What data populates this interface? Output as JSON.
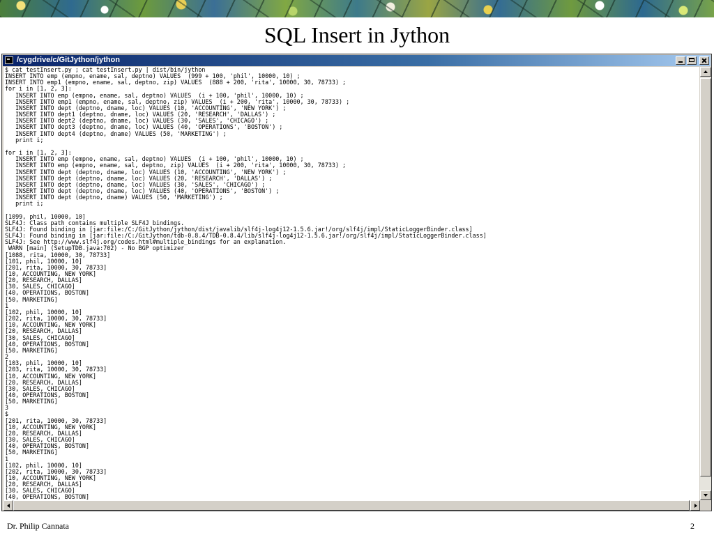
{
  "slide": {
    "title": "SQL Insert in Jython",
    "author": "Dr. Philip Cannata",
    "page_number": "2"
  },
  "window": {
    "title": "/cygdrive/c/GitJython/jython",
    "buttons": [
      "minimize-icon",
      "maximize-icon",
      "close-icon"
    ],
    "terminal_lines": [
      "$ cat testInsert.py ; cat testInsert.py | dist/bin/jython",
      "INSERT INTO emp (empno, ename, sal, deptno) VALUES  (999 + 100, 'phil', 10000, 10) ;",
      "INSERT INTO emp1 (empno, ename, sal, deptno, zip) VALUES  (888 + 200, 'rita', 10000, 30, 78733) ;",
      "for i in [1, 2, 3]:",
      "   INSERT INTO emp (empno, ename, sal, deptno) VALUES  (i + 100, 'phil', 10000, 10) ;",
      "   INSERT INTO emp1 (empno, ename, sal, deptno, zip) VALUES  (i + 200, 'rita', 10000, 30, 78733) ;",
      "   INSERT INTO dept (deptno, dname, loc) VALUES (10, 'ACCOUNTING', 'NEW YORK') ;",
      "   INSERT INTO dept1 (deptno, dname, loc) VALUES (20, 'RESEARCH', 'DALLAS') ;",
      "   INSERT INTO dept2 (deptno, dname, loc) VALUES (30, 'SALES', 'CHICAGO') ;",
      "   INSERT INTO dept3 (deptno, dname, loc) VALUES (40, 'OPERATIONS', 'BOSTON') ;",
      "   INSERT INTO dept4 (deptno, dname) VALUES (50, 'MARKETING') ;",
      "   print i;",
      "",
      "for i in [1, 2, 3]:",
      "   INSERT INTO emp (empno, ename, sal, deptno) VALUES  (i + 100, 'phil', 10000, 10) ;",
      "   INSERT INTO emp (empno, ename, sal, deptno, zip) VALUES  (i + 200, 'rita', 10000, 30, 78733) ;",
      "   INSERT INTO dept (deptno, dname, loc) VALUES (10, 'ACCOUNTING', 'NEW YORK') ;",
      "   INSERT INTO dept (deptno, dname, loc) VALUES (20, 'RESEARCH', 'DALLAS') ;",
      "   INSERT INTO dept (deptno, dname, loc) VALUES (30, 'SALES', 'CHICAGO') ;",
      "   INSERT INTO dept (deptno, dname, loc) VALUES (40, 'OPERATIONS', 'BOSTON') ;",
      "   INSERT INTO dept (deptno, dname) VALUES (50, 'MARKETING') ;",
      "   print i;",
      "",
      "[1099, phil, 10000, 10]",
      "SLF4J: Class path contains multiple SLF4J bindings.",
      "SLF4J: Found binding in [jar:file:/C:/GitJython/jython/dist/javalib/slf4j-log4j12-1.5.6.jar!/org/slf4j/impl/StaticLoggerBinder.class]",
      "SLF4J: Found binding in [jar:file:/C:/GitJython/tdb-0.8.4/TDB-0.8.4/lib/slf4j-log4j12-1.5.6.jar!/org/slf4j/impl/StaticLoggerBinder.class]",
      "SLF4J: See http://www.slf4j.org/codes.html#multiple_bindings for an explanation.",
      " WARN [main] (SetupTDB.java:702) - No BGP optimizer",
      "[1088, rita, 10000, 30, 78733]",
      "[101, phil, 10000, 10]",
      "[201, rita, 10000, 30, 78733]",
      "[10, ACCOUNTING, NEW YORK]",
      "[20, RESEARCH, DALLAS]",
      "[30, SALES, CHICAGO]",
      "[40, OPERATIONS, BOSTON]",
      "[50, MARKETING]",
      "1",
      "[102, phil, 10000, 10]",
      "[202, rita, 10000, 30, 78733]",
      "[10, ACCOUNTING, NEW YORK]",
      "[20, RESEARCH, DALLAS]",
      "[30, SALES, CHICAGO]",
      "[40, OPERATIONS, BOSTON]",
      "[50, MARKETING]",
      "2",
      "[103, phil, 10000, 10]",
      "[203, rita, 10000, 30, 78733]",
      "[10, ACCOUNTING, NEW YORK]",
      "[20, RESEARCH, DALLAS]",
      "[30, SALES, CHICAGO]",
      "[40, OPERATIONS, BOSTON]",
      "[50, MARKETING]",
      "3",
      "$",
      "[201, rita, 10000, 30, 78733]",
      "[10, ACCOUNTING, NEW YORK]",
      "[20, RESEARCH, DALLAS]",
      "[30, SALES, CHICAGO]",
      "[40, OPERATIONS, BOSTON]",
      "[50, MARKETING]",
      "1",
      "[102, phil, 10000, 10]",
      "[202, rita, 10000, 30, 78733]",
      "[10, ACCOUNTING, NEW YORK]",
      "[20, RESEARCH, DALLAS]",
      "[30, SALES, CHICAGO]",
      "[40, OPERATIONS, BOSTON]"
    ]
  },
  "colors": {
    "titlebar_start": "#0a246a",
    "titlebar_end": "#a6caf0",
    "window_chrome": "#d4d0c8",
    "terminal_bg": "#ffffff",
    "terminal_fg": "#000000"
  }
}
